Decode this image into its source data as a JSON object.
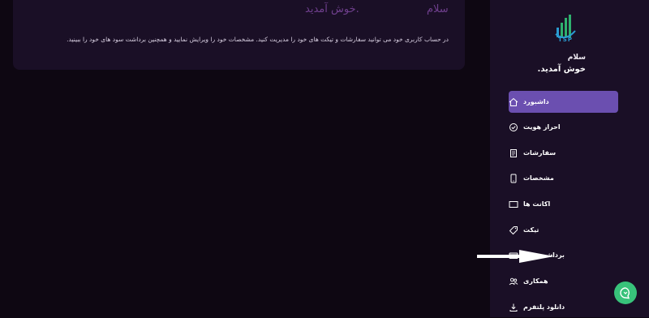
{
  "main": {
    "greeting": "سلام",
    "welcome": "خوش آمدید.",
    "description": "در حساب کاربری خود می توانید سفارشات و تیکت های خود را مدیریت کنید. مشخصات خود را ویرایش نمایید و همچنین برداشت سود های خود را ببینید."
  },
  "sidebar": {
    "logo_text": "TSP",
    "greeting": "سلام",
    "welcome": "خوش آمدید.",
    "items": [
      {
        "label": "داشبورد",
        "icon": "home-icon",
        "active": true
      },
      {
        "label": "احراز هویت",
        "icon": "check-circle-icon"
      },
      {
        "label": "سفارشات",
        "icon": "orders-icon"
      },
      {
        "label": "مشخصات",
        "icon": "phone-icon"
      },
      {
        "label": "اکانت ها",
        "icon": "monitor-icon"
      },
      {
        "label": "تیکت",
        "icon": "tag-icon"
      },
      {
        "label": "برداشت سود",
        "icon": "card-icon"
      },
      {
        "label": "همکاری",
        "icon": "users-icon"
      },
      {
        "label": "دانلود پلتفرم",
        "icon": "download-icon"
      }
    ]
  },
  "colors": {
    "background": "#0e0712",
    "panel": "#1a0f26",
    "accent": "#6b4fb0",
    "chat": "#38c27a"
  }
}
